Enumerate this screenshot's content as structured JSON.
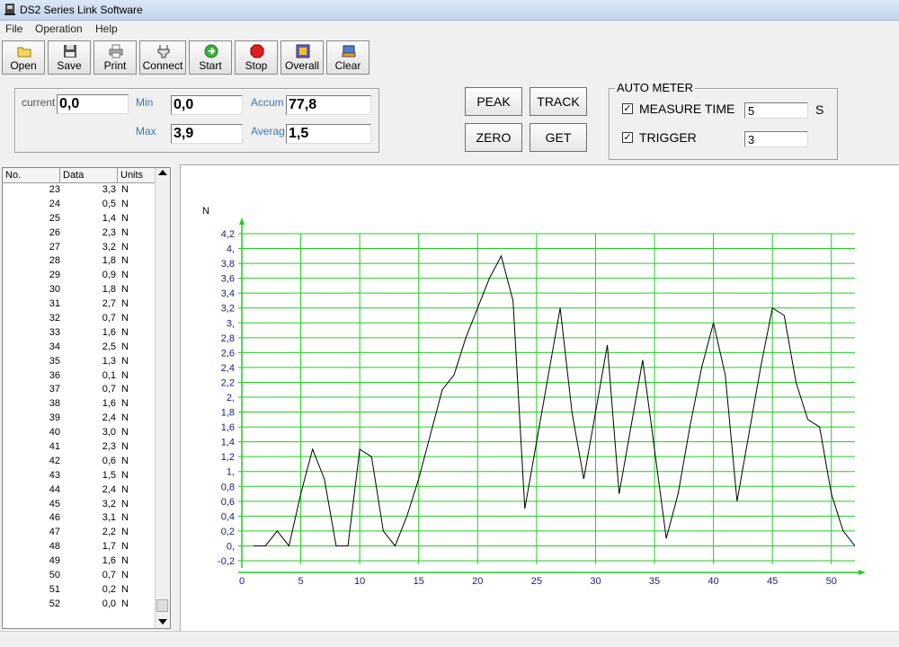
{
  "window": {
    "title": "DS2 Series Link Software"
  },
  "menu": [
    "File",
    "Operation",
    "Help"
  ],
  "toolbar": [
    {
      "label": "Open",
      "icon": "folder-icon"
    },
    {
      "label": "Save",
      "icon": "floppy-icon"
    },
    {
      "label": "Print",
      "icon": "printer-icon"
    },
    {
      "label": "Connect",
      "icon": "plug-icon"
    },
    {
      "label": "Start",
      "icon": "start-icon"
    },
    {
      "label": "Stop",
      "icon": "stop-icon"
    },
    {
      "label": "Overall",
      "icon": "overall-icon"
    },
    {
      "label": "Clear",
      "icon": "clear-icon"
    }
  ],
  "readings": {
    "current_label": "current",
    "current": "0,0",
    "min_label": "Min",
    "min": "0,0",
    "max_label": "Max",
    "max": "3,9",
    "accum_label": "Accum",
    "accum": "77,8",
    "average_label": "Averag",
    "average": "1,5"
  },
  "buttons": {
    "peak": "PEAK",
    "track": "TRACK",
    "zero": "ZERO",
    "get": "GET"
  },
  "auto_meter": {
    "title": "AUTO METER",
    "measure_time_label": "MEASURE TIME",
    "measure_time_value": "5",
    "measure_time_unit": "S",
    "trigger_label": "TRIGGER",
    "trigger_value": "3",
    "measure_time_checked": true,
    "trigger_checked": true
  },
  "table": {
    "headers": [
      "No.",
      "Data",
      "Units"
    ],
    "rows": [
      [
        "23",
        "3,3",
        "N"
      ],
      [
        "24",
        "0,5",
        "N"
      ],
      [
        "25",
        "1,4",
        "N"
      ],
      [
        "26",
        "2,3",
        "N"
      ],
      [
        "27",
        "3,2",
        "N"
      ],
      [
        "28",
        "1,8",
        "N"
      ],
      [
        "29",
        "0,9",
        "N"
      ],
      [
        "30",
        "1,8",
        "N"
      ],
      [
        "31",
        "2,7",
        "N"
      ],
      [
        "32",
        "0,7",
        "N"
      ],
      [
        "33",
        "1,6",
        "N"
      ],
      [
        "34",
        "2,5",
        "N"
      ],
      [
        "35",
        "1,3",
        "N"
      ],
      [
        "36",
        "0,1",
        "N"
      ],
      [
        "37",
        "0,7",
        "N"
      ],
      [
        "38",
        "1,6",
        "N"
      ],
      [
        "39",
        "2,4",
        "N"
      ],
      [
        "40",
        "3,0",
        "N"
      ],
      [
        "41",
        "2,3",
        "N"
      ],
      [
        "42",
        "0,6",
        "N"
      ],
      [
        "43",
        "1,5",
        "N"
      ],
      [
        "44",
        "2,4",
        "N"
      ],
      [
        "45",
        "3,2",
        "N"
      ],
      [
        "46",
        "3,1",
        "N"
      ],
      [
        "47",
        "2,2",
        "N"
      ],
      [
        "48",
        "1,7",
        "N"
      ],
      [
        "49",
        "1,6",
        "N"
      ],
      [
        "50",
        "0,7",
        "N"
      ],
      [
        "51",
        "0,2",
        "N"
      ],
      [
        "52",
        "0,0",
        "N"
      ]
    ]
  },
  "chart_data": {
    "type": "line",
    "ylabel": "N",
    "x_ticks": [
      "0",
      "5",
      "10",
      "15",
      "20",
      "25",
      "30",
      "35",
      "40",
      "45",
      "50"
    ],
    "y_ticks": [
      "4,2",
      "4,",
      "3,8",
      "3,6",
      "3,4",
      "3,2",
      "3,",
      "2,8",
      "2,6",
      "2,4",
      "2,2",
      "2,",
      "1,8",
      "1,6",
      "1,4",
      "1,2",
      "1,",
      "0,8",
      "0,6",
      "0,4",
      "0,2",
      "0,",
      "-0,2"
    ],
    "xlim": [
      0,
      52
    ],
    "ylim": [
      -0.2,
      4.2
    ],
    "grid": true,
    "colors": {
      "grid": "#22cc22",
      "line": "#000000",
      "axis_text": "#1a1a80"
    },
    "series": [
      {
        "x": [
          1,
          2,
          3,
          4,
          5,
          6,
          7,
          8,
          9,
          10,
          11,
          12,
          13,
          14,
          15,
          16,
          17,
          18,
          19,
          20,
          21,
          22,
          23,
          24,
          25,
          26,
          27,
          28,
          29,
          30,
          31,
          32,
          33,
          34,
          35,
          36,
          37,
          38,
          39,
          40,
          41,
          42,
          43,
          44,
          45,
          46,
          47,
          48,
          49,
          50,
          51,
          52
        ],
        "values": [
          0,
          0,
          0.2,
          0,
          0.7,
          1.3,
          0.9,
          0,
          0,
          1.3,
          1.2,
          0.2,
          0,
          0.4,
          0.9,
          1.5,
          2.1,
          2.3,
          2.8,
          3.2,
          3.6,
          3.9,
          3.3,
          0.5,
          1.4,
          2.3,
          3.2,
          1.8,
          0.9,
          1.8,
          2.7,
          0.7,
          1.6,
          2.5,
          1.3,
          0.1,
          0.7,
          1.6,
          2.4,
          3.0,
          2.3,
          0.6,
          1.5,
          2.4,
          3.2,
          3.1,
          2.2,
          1.7,
          1.6,
          0.7,
          0.2,
          0.0
        ]
      }
    ]
  }
}
